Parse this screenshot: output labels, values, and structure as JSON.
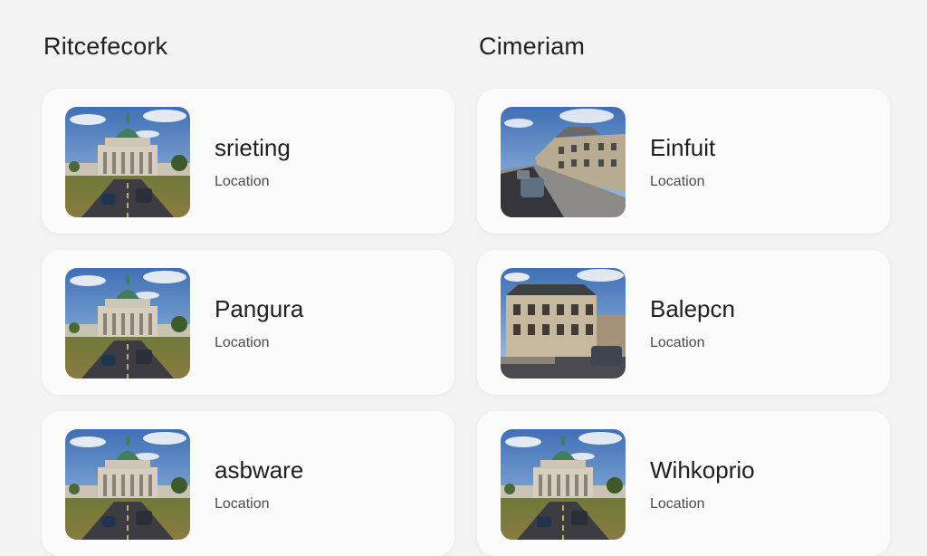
{
  "columns": [
    {
      "title": "Ritcefecork",
      "cards": [
        {
          "name": "srieting",
          "location": "Location",
          "image": "domed-building-photo"
        },
        {
          "name": "Pangura",
          "location": "Location",
          "image": "domed-building-photo"
        },
        {
          "name": "asbware",
          "location": "Location",
          "image": "domed-building-photo"
        }
      ]
    },
    {
      "title": "Cimeriam",
      "cards": [
        {
          "name": "Einfuit",
          "location": "Location",
          "image": "street-terrace-photo"
        },
        {
          "name": "Balepcn",
          "location": "Location",
          "image": "mansion-street-photo"
        },
        {
          "name": "Wihkoprio",
          "location": "Location",
          "image": "domed-building-photo"
        }
      ]
    }
  ],
  "colors": {
    "background": "#f3f3f3",
    "card": "#fbfbfb",
    "text": "#202020",
    "secondary_text": "#4c4c4c"
  }
}
